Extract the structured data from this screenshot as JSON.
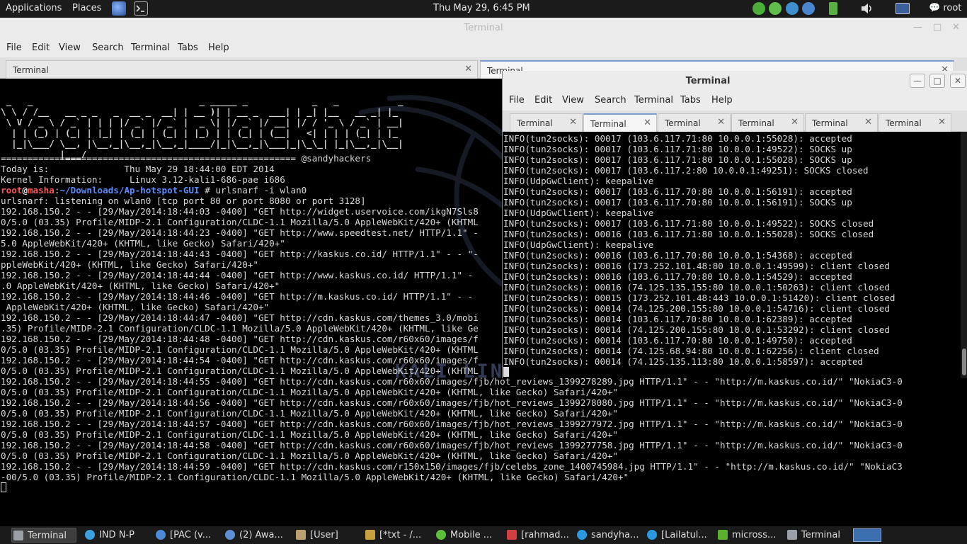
{
  "top_panel": {
    "apps": "Applications",
    "places": "Places",
    "clock": "Thu May 29,  6:45 PM",
    "user": "root"
  },
  "back_window": {
    "title": "Terminal",
    "menu": [
      "File",
      "Edit",
      "View",
      "Search",
      "Terminal",
      "Tabs",
      "Help"
    ],
    "tabs": [
      {
        "label": "Terminal",
        "close": "✕"
      },
      {
        "label": "Terminal",
        "close": "✕"
      }
    ],
    "banner": " _   _                               _ _____ _            _   _           _   \n\\ \\ / /__   __ _ _   _  __ _  __| | __ )| | __ _  ___| | _| |__   __ _| |_ \n \\ V / _ \\ / _` | | | |/ _` |/ _` |  _ \\| |/ _` |/ __| |/ / '_ \\ / _` | __|\n  | | (_) | (_| | |_| | (_| | (_| | |_) | | (_| | (__|   <| | | | (_| | |_ \n  |_|\\___/ \\__, |\\__,_|\\__,_|\\__,_|____/|_|\\__,_|\\___|_|\\_\\_| |_|\\__,_|\\__|\n           |___/",
    "separator": "======================================================= @sandyhackers",
    "info_lines": [
      "Today is:              Thu May 29 18:44:00 EDT 2014",
      "Kernel Information:     Linux 3.12-kali1-686-pae i686"
    ],
    "prompt_user": "root",
    "prompt_host": "masha",
    "prompt_path": "~/Downloads/Ap-hotspot-GUI",
    "prompt_cmd": " # urlsnarf -i wlan0",
    "output_lines": [
      "urlsnarf: listening on wlan0 [tcp port 80 or port 8080 or port 3128]",
      "192.168.150.2 - - [29/May/2014:18:44:03 -0400] \"GET http://widget.uservoice.com/ikgN7Sls8",
      "0/5.0 (03.35) Profile/MIDP-2.1 Configuration/CLDC-1.1 Mozilla/5.0 AppleWebKit/420+ (KHTML",
      "192.168.150.2 - - [29/May/2014:18:44:23 -0400] \"GET http://www.speedtest.net/ HTTP/1.1\" -",
      "5.0 AppleWebKit/420+ (KHTML, like Gecko) Safari/420+\"",
      "192.168.150.2 - - [29/May/2014:18:44:43 -0400] \"GET http://kaskus.co.id/ HTTP/1.1\" - - \"-",
      "ppleWebKit/420+ (KHTML, like Gecko) Safari/420+\"",
      "192.168.150.2 - - [29/May/2014:18:44:44 -0400] \"GET http://www.kaskus.co.id/ HTTP/1.1\" -",
      ".0 AppleWebKit/420+ (KHTML, like Gecko) Safari/420+\"",
      "192.168.150.2 - - [29/May/2014:18:44:46 -0400] \"GET http://m.kaskus.co.id/ HTTP/1.1\" - -",
      " AppleWebKit/420+ (KHTML, like Gecko) Safari/420+\"",
      "192.168.150.2 - - [29/May/2014:18:44:47 -0400] \"GET http://cdn.kaskus.com/themes_3.0/mobi",
      ".35) Profile/MIDP-2.1 Configuration/CLDC-1.1 Mozilla/5.0 AppleWebKit/420+ (KHTML, like Ge",
      "192.168.150.2 - - [29/May/2014:18:44:48 -0400] \"GET http://cdn.kaskus.com/r60x60/images/f",
      "0/5.0 (03.35) Profile/MIDP-2.1 Configuration/CLDC-1.1 Mozilla/5.0 AppleWebKit/420+ (KHTML",
      "192.168.150.2 - - [29/May/2014:18:44:54 -0400] \"GET http://cdn.kaskus.com/r60x60/images/f",
      "0/5.0 (03.35) Profile/MIDP-2.1 Configuration/CLDC-1.1 Mozilla/5.0 AppleWebKit/420+ (KHTML",
      "192.168.150.2 - - [29/May/2014:18:44:55 -0400] \"GET http://cdn.kaskus.com/r60x60/images/fjb/hot_reviews_1399278289.jpg HTTP/1.1\" - - \"http://m.kaskus.co.id/\" \"NokiaC3-0",
      "0/5.0 (03.35) Profile/MIDP-2.1 Configuration/CLDC-1.1 Mozilla/5.0 AppleWebKit/420+ (KHTML, like Gecko) Safari/420+\"",
      "192.168.150.2 - - [29/May/2014:18:44:56 -0400] \"GET http://cdn.kaskus.com/r60x60/images/fjb/hot_reviews_1399278080.jpg HTTP/1.1\" - - \"http://m.kaskus.co.id/\" \"NokiaC3-0",
      "0/5.0 (03.35) Profile/MIDP-2.1 Configuration/CLDC-1.1 Mozilla/5.0 AppleWebKit/420+ (KHTML, like Gecko) Safari/420+\"",
      "192.168.150.2 - - [29/May/2014:18:44:57 -0400] \"GET http://cdn.kaskus.com/r60x60/images/fjb/hot_reviews_1399277972.jpg HTTP/1.1\" - - \"http://m.kaskus.co.id/\" \"NokiaC3-0",
      "0/5.0 (03.35) Profile/MIDP-2.1 Configuration/CLDC-1.1 Mozilla/5.0 AppleWebKit/420+ (KHTML, like Gecko) Safari/420+\"",
      "192.168.150.2 - - [29/May/2014:18:44:58 -0400] \"GET http://cdn.kaskus.com/r60x60/images/fjb/hot_reviews_1399277758.jpg HTTP/1.1\" - - \"http://m.kaskus.co.id/\" \"NokiaC3-0",
      "0/5.0 (03.35) Profile/MIDP-2.1 Configuration/CLDC-1.1 Mozilla/5.0 AppleWebKit/420+ (KHTML, like Gecko) Safari/420+\"",
      "192.168.150.2 - - [29/May/2014:18:44:59 -0400] \"GET http://cdn.kaskus.com/r150x150/images/fjb/celebs_zone_1400745984.jpg HTTP/1.1\" - - \"http://m.kaskus.co.id/\" \"NokiaC3",
      "-00/5.0 (03.35) Profile/MIDP-2.1 Configuration/CLDC-1.1 Mozilla/5.0 AppleWebKit/420+ (KHTML, like Gecko) Safari/420+\""
    ],
    "watermark": "KALI LINUX"
  },
  "front_window": {
    "title": "Terminal",
    "buttons": {
      "minimize": "—",
      "maximize": "□",
      "close": "✕"
    },
    "menu": [
      "File",
      "Edit",
      "View",
      "Search",
      "Terminal",
      "Tabs",
      "Help"
    ],
    "tabs": [
      {
        "label": "Terminal",
        "close": "✕"
      },
      {
        "label": "Terminal",
        "close": "✕"
      },
      {
        "label": "Terminal",
        "close": "✕"
      },
      {
        "label": "Terminal",
        "close": "✕"
      },
      {
        "label": "Terminal",
        "close": "✕"
      },
      {
        "label": "Terminal",
        "close": "✕"
      }
    ],
    "log_lines": [
      "INFO(tun2socks): 00017 (103.6.117.71:80 10.0.0.1:55028): accepted",
      "INFO(tun2socks): 00017 (103.6.117.71:80 10.0.0.1:49522): SOCKS up",
      "INFO(tun2socks): 00017 (103.6.117.71:80 10.0.0.1:55028): SOCKS up",
      "INFO(tun2socks): 00017 (103.6.117.2:80 10.0.0.1:49251): SOCKS closed",
      "INFO(UdpGwClient): keepalive",
      "INFO(tun2socks): 00017 (103.6.117.70:80 10.0.0.1:56191): accepted",
      "INFO(tun2socks): 00017 (103.6.117.70:80 10.0.0.1:56191): SOCKS up",
      "INFO(UdpGwClient): keepalive",
      "INFO(tun2socks): 00017 (103.6.117.71:80 10.0.0.1:49522): SOCKS closed",
      "INFO(tun2socks): 00016 (103.6.117.71:80 10.0.0.1:55028): SOCKS closed",
      "INFO(UdpGwClient): keepalive",
      "INFO(tun2socks): 00016 (103.6.117.70:80 10.0.0.1:54368): accepted",
      "INFO(tun2socks): 00016 (173.252.101.48:80 10.0.0.1:49599): client closed",
      "INFO(tun2socks): 00016 (103.6.117.70:80 10.0.0.1:54529): accepted",
      "INFO(tun2socks): 00016 (74.125.135.155:80 10.0.0.1:50263): client closed",
      "INFO(tun2socks): 00015 (173.252.101.48:443 10.0.0.1:51420): client closed",
      "INFO(tun2socks): 00014 (74.125.200.155:80 10.0.0.1:54716): client closed",
      "INFO(tun2socks): 00014 (103.6.117.70:80 10.0.0.1:62389): accepted",
      "INFO(tun2socks): 00014 (74.125.200.155:80 10.0.0.1:53292): client closed",
      "INFO(tun2socks): 00014 (103.6.117.70:80 10.0.0.1:49750): accepted",
      "INFO(tun2socks): 00014 (74.125.68.94:80 10.0.0.1:62256): client closed",
      "INFO(tun2socks): 00014 (74.125.135.113:80 10.0.0.1:58597): accepted"
    ]
  },
  "taskbar": {
    "tasks": [
      {
        "label": "Terminal",
        "icon": "terminal-icon",
        "color": "#9aa0a6"
      },
      {
        "label": "IND N-P",
        "icon": "browser-icon",
        "color": "#3aa0e0"
      },
      {
        "label": "[PAC (v...",
        "icon": "globe-icon",
        "color": "#4a8ad8"
      },
      {
        "label": "(2) Awa...",
        "icon": "chromium-icon",
        "color": "#5b8fd6"
      },
      {
        "label": "[User]",
        "icon": "folder-icon",
        "color": "#b8a070"
      },
      {
        "label": "[*txt - /...",
        "icon": "text-editor-icon",
        "color": "#c8a040"
      },
      {
        "label": "Mobile ...",
        "icon": "chat-icon",
        "color": "#5cbf3a"
      },
      {
        "label": "[rahmad...",
        "icon": "vim-icon",
        "color": "#d04040"
      },
      {
        "label": "sandyha...",
        "icon": "skype-icon",
        "color": "#2a9ae0"
      },
      {
        "label": "[Lailatul...",
        "icon": "skype-icon",
        "color": "#2a9ae0"
      },
      {
        "label": "micross...",
        "icon": "document-icon",
        "color": "#5cb030"
      },
      {
        "label": "Terminal",
        "icon": "terminal-icon",
        "color": "#9aa0a6"
      }
    ]
  }
}
